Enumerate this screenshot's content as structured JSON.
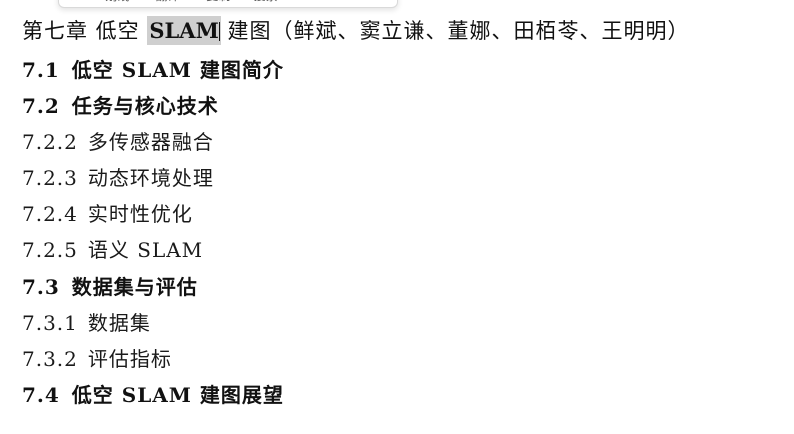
{
  "toolbar": {
    "items": [
      {
        "icon": "pin-icon",
        "label": "划线"
      },
      {
        "icon": "translate-icon",
        "label": "翻译"
      },
      {
        "icon": "copy-icon",
        "label": "复制"
      },
      {
        "icon": "search-icon",
        "label": "搜索"
      }
    ]
  },
  "doc": {
    "title_prefix": "第七章 低空 ",
    "title_selected": "SLAM",
    "title_suffix": " 建图（鲜斌、窦立谦、董娜、田栢苓、王明明）",
    "lines": [
      {
        "num": "7.1",
        "text": "低空 SLAM 建图简介",
        "kind": "section"
      },
      {
        "num": "7.2",
        "text": "任务与核心技术",
        "kind": "section"
      },
      {
        "num": "7.2.2",
        "text": "多传感器融合",
        "kind": "sub"
      },
      {
        "num": "7.2.3",
        "text": "动态环境处理",
        "kind": "sub"
      },
      {
        "num": "7.2.4",
        "text": "实时性优化",
        "kind": "sub"
      },
      {
        "num": "7.2.5",
        "text": "语义 SLAM",
        "kind": "sub"
      },
      {
        "num": "7.3",
        "text": "数据集与评估",
        "kind": "section"
      },
      {
        "num": "7.3.1",
        "text": "数据集",
        "kind": "sub"
      },
      {
        "num": "7.3.2",
        "text": "评估指标",
        "kind": "sub"
      },
      {
        "num": "7.4",
        "text": "低空 SLAM 建图展望",
        "kind": "section"
      }
    ]
  }
}
